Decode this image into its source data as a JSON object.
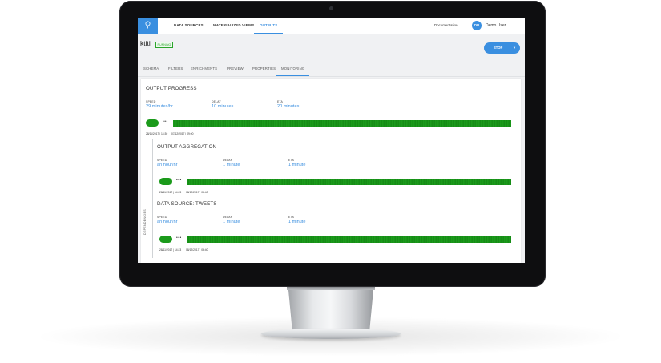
{
  "topnav": {
    "logo_icon": "bulb-icon",
    "tabs": [
      "DATA SOURCES",
      "MATERIALIZED VIEWS",
      "OUTPUTS"
    ],
    "documentation": "Documentation",
    "user_initials": "DU",
    "user_name": "Demo User"
  },
  "header": {
    "name": "ktiti",
    "status": "RUNNING",
    "stop_label": "STOP",
    "stop_arrow": "▼"
  },
  "tabs": [
    "SCHEMA",
    "FILTERS",
    "ENRICHMENTS",
    "PREVIEW",
    "PROPERTIES",
    "MONITORING"
  ],
  "active_tab": "MONITORING",
  "dependencies_label": "DEPENDENCIES",
  "sections": [
    {
      "title": "OUTPUT PROGRESS",
      "metrics": [
        {
          "label": "SPEED",
          "value": "29 minutes/hr"
        },
        {
          "label": "DELAY",
          "value": "10 minutes"
        },
        {
          "label": "ETA",
          "value": "20 minutes"
        }
      ],
      "dots": "•••",
      "progress": 1.0,
      "start_time": "28/11/2017 | 14:30",
      "end_time": "07/12/2017 | 09:00"
    },
    {
      "title": "OUTPUT AGGREGATION",
      "metrics": [
        {
          "label": "SPEED",
          "value": "an hour/hr"
        },
        {
          "label": "DELAY",
          "value": "1 minute"
        },
        {
          "label": "ETA",
          "value": "1 minute"
        }
      ],
      "dots": "•••",
      "progress": 1.0,
      "start_time": "28/11/2017 | 14:23",
      "end_time": "08/12/2017 | 06:40"
    },
    {
      "title": "DATA SOURCE: TWEETS",
      "metrics": [
        {
          "label": "SPEED",
          "value": "an hour/hr"
        },
        {
          "label": "DELAY",
          "value": "1 minute"
        },
        {
          "label": "ETA",
          "value": "1 minute"
        }
      ],
      "dots": "•••",
      "progress": 1.0,
      "start_time": "28/11/2017 | 14:23",
      "end_time": "08/12/2017 | 06:40"
    }
  ],
  "colors": {
    "accent": "#3a8fe0",
    "progress_green": "#1b9a1b",
    "running_green": "#2aa52a"
  }
}
